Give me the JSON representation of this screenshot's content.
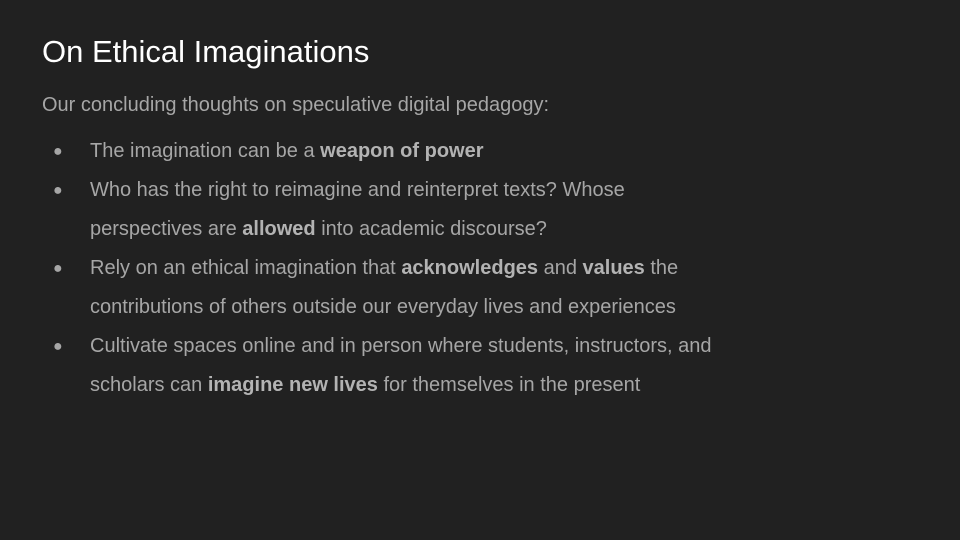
{
  "slide": {
    "title": "On Ethical Imaginations",
    "subtitle": "Our concluding thoughts on speculative digital pedagogy:",
    "bullet_glyph": "●",
    "bullets": [
      {
        "segments": [
          {
            "text": "The imagination can be a ",
            "bold": false
          },
          {
            "text": "weapon of power",
            "bold": true
          }
        ]
      },
      {
        "segments": [
          {
            "text": "Who has the right to reimagine and reinterpret texts? Whose perspectives are ",
            "bold": false
          },
          {
            "text": "allowed",
            "bold": true
          },
          {
            "text": " into academic discourse?",
            "bold": false
          }
        ]
      },
      {
        "segments": [
          {
            "text": "Rely on an ethical imagination that ",
            "bold": false
          },
          {
            "text": "acknowledges",
            "bold": true
          },
          {
            "text": " and ",
            "bold": false
          },
          {
            "text": "values",
            "bold": true
          },
          {
            "text": " the contributions of others outside our everyday lives and experiences",
            "bold": false
          }
        ]
      },
      {
        "segments": [
          {
            "text": "Cultivate spaces online and in person where students, instructors, and scholars can ",
            "bold": false
          },
          {
            "text": "imagine new lives",
            "bold": true
          },
          {
            "text": " for themselves in the present",
            "bold": false
          }
        ]
      }
    ]
  },
  "colors": {
    "background": "#212121",
    "title": "#ffffff",
    "body_text": "#a6a6a6"
  }
}
